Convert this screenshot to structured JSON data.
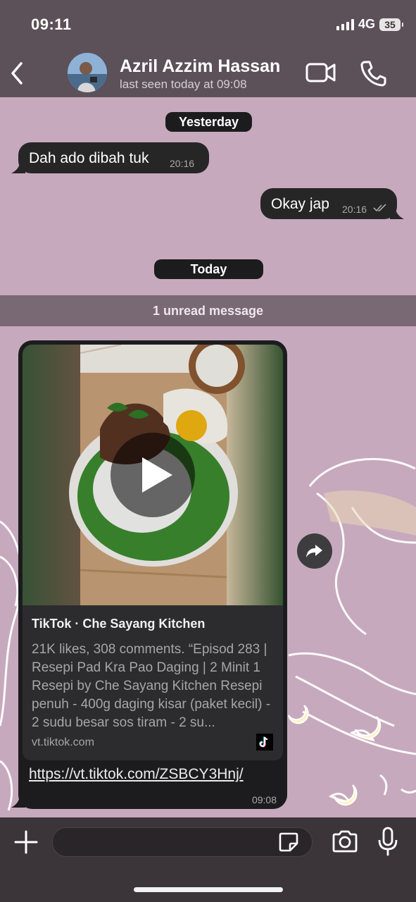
{
  "status_bar": {
    "time": "09:11",
    "network": "4G",
    "battery": "35"
  },
  "header": {
    "contact_name": "Azril Azzim Hassan",
    "last_seen": "last seen today at 09:08"
  },
  "chat": {
    "date_yesterday": "Yesterday",
    "date_today": "Today",
    "unread_banner": "1 unread message",
    "messages": [
      {
        "direction": "incoming",
        "text": "Dah ado dibah tuk",
        "time": "20:16"
      },
      {
        "direction": "outgoing",
        "text": "Okay jap",
        "time": "20:16",
        "status": "read"
      }
    ],
    "link_message": {
      "preview_title": "TikTok · Che Sayang Kitchen",
      "preview_description": "21K likes, 308 comments. “Episod 283 | Resepi Pad Kra Pao Daging | 2 Minit 1 Resepi by Che Sayang Kitchen Resepi penuh - 400g daging kisar (paket kecil) - 2 sudu besar sos tiram - 2 su...",
      "preview_domain": "vt.tiktok.com",
      "url": "https://vt.tiktok.com/ZSBCY3Hnj/",
      "time": "09:08"
    }
  },
  "icons": {
    "back": "chevron-left-icon",
    "video_call": "video-camera-icon",
    "voice_call": "phone-icon",
    "play": "play-icon",
    "share": "share-forward-icon",
    "attach": "plus-icon",
    "sticker": "sticker-icon",
    "camera": "camera-icon",
    "mic": "microphone-icon"
  },
  "colors": {
    "header_bg": "#5c5059",
    "wallpaper": "#c7a9bd",
    "bubble": "#262626",
    "chip": "#1c1c1e"
  }
}
